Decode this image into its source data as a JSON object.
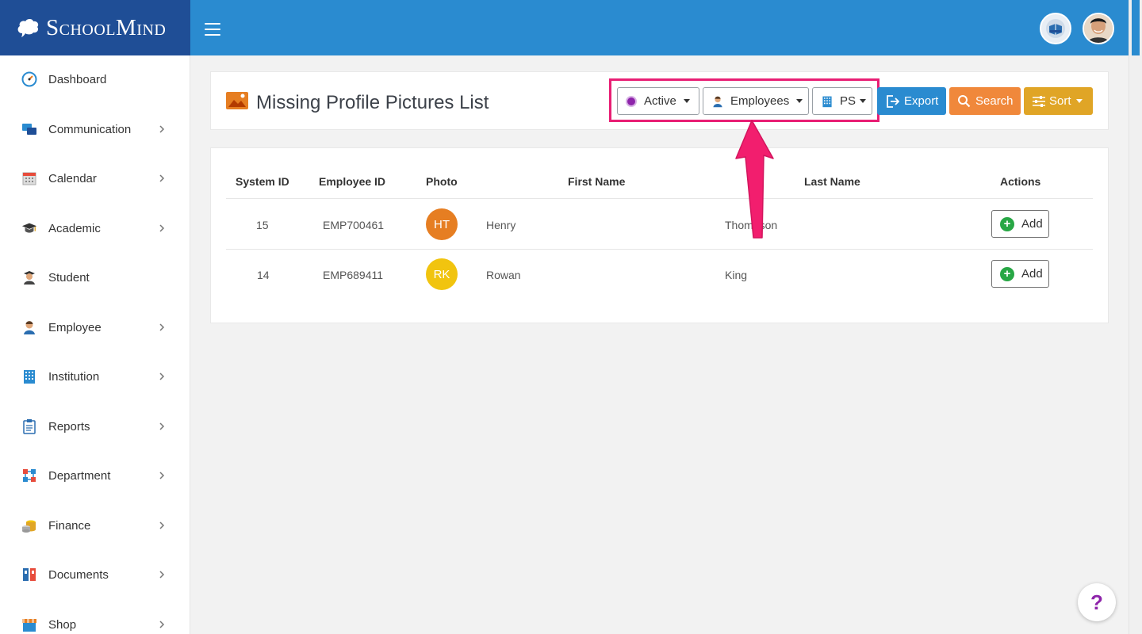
{
  "brand": {
    "name": "SchoolMind"
  },
  "sidebar": {
    "items": [
      {
        "label": "Dashboard",
        "icon": "dashboard-icon",
        "has_submenu": false
      },
      {
        "label": "Communication",
        "icon": "chat-icon",
        "has_submenu": true
      },
      {
        "label": "Calendar",
        "icon": "calendar-icon",
        "has_submenu": true
      },
      {
        "label": "Academic",
        "icon": "graduation-cap-icon",
        "has_submenu": true
      },
      {
        "label": "Student",
        "icon": "student-icon",
        "has_submenu": false
      },
      {
        "label": "Employee",
        "icon": "employee-icon",
        "has_submenu": true
      },
      {
        "label": "Institution",
        "icon": "building-icon",
        "has_submenu": true
      },
      {
        "label": "Reports",
        "icon": "clipboard-icon",
        "has_submenu": true
      },
      {
        "label": "Department",
        "icon": "hierarchy-icon",
        "has_submenu": true
      },
      {
        "label": "Finance",
        "icon": "coins-icon",
        "has_submenu": true
      },
      {
        "label": "Documents",
        "icon": "binders-icon",
        "has_submenu": true
      },
      {
        "label": "Shop",
        "icon": "shop-icon",
        "has_submenu": true
      }
    ]
  },
  "header": {
    "title": "Missing Profile Pictures List",
    "filters": {
      "status": "Active",
      "type": "Employees",
      "institution": "PS"
    },
    "actions": {
      "export": "Export",
      "search": "Search",
      "sort": "Sort"
    }
  },
  "table": {
    "columns": [
      "System ID",
      "Employee ID",
      "Photo",
      "First Name",
      "Last Name",
      "Actions"
    ],
    "rows": [
      {
        "system_id": "15",
        "employee_id": "EMP700461",
        "initials": "HT",
        "photo_color": "#e67e22",
        "first_name": "Henry",
        "last_name": "Thompson",
        "action": "Add"
      },
      {
        "system_id": "14",
        "employee_id": "EMP689411",
        "initials": "RK",
        "photo_color": "#f1c40f",
        "first_name": "Rowan",
        "last_name": "King",
        "action": "Add"
      }
    ]
  },
  "help": {
    "label": "?"
  },
  "colors": {
    "brand_bg": "#1f4e96",
    "topbar_bg": "#2a8bd0",
    "export_btn": "#2a8bd0",
    "search_btn": "#f0883b",
    "sort_btn": "#e0a526",
    "highlight": "#e81e74",
    "status_active": "#8e24aa"
  }
}
